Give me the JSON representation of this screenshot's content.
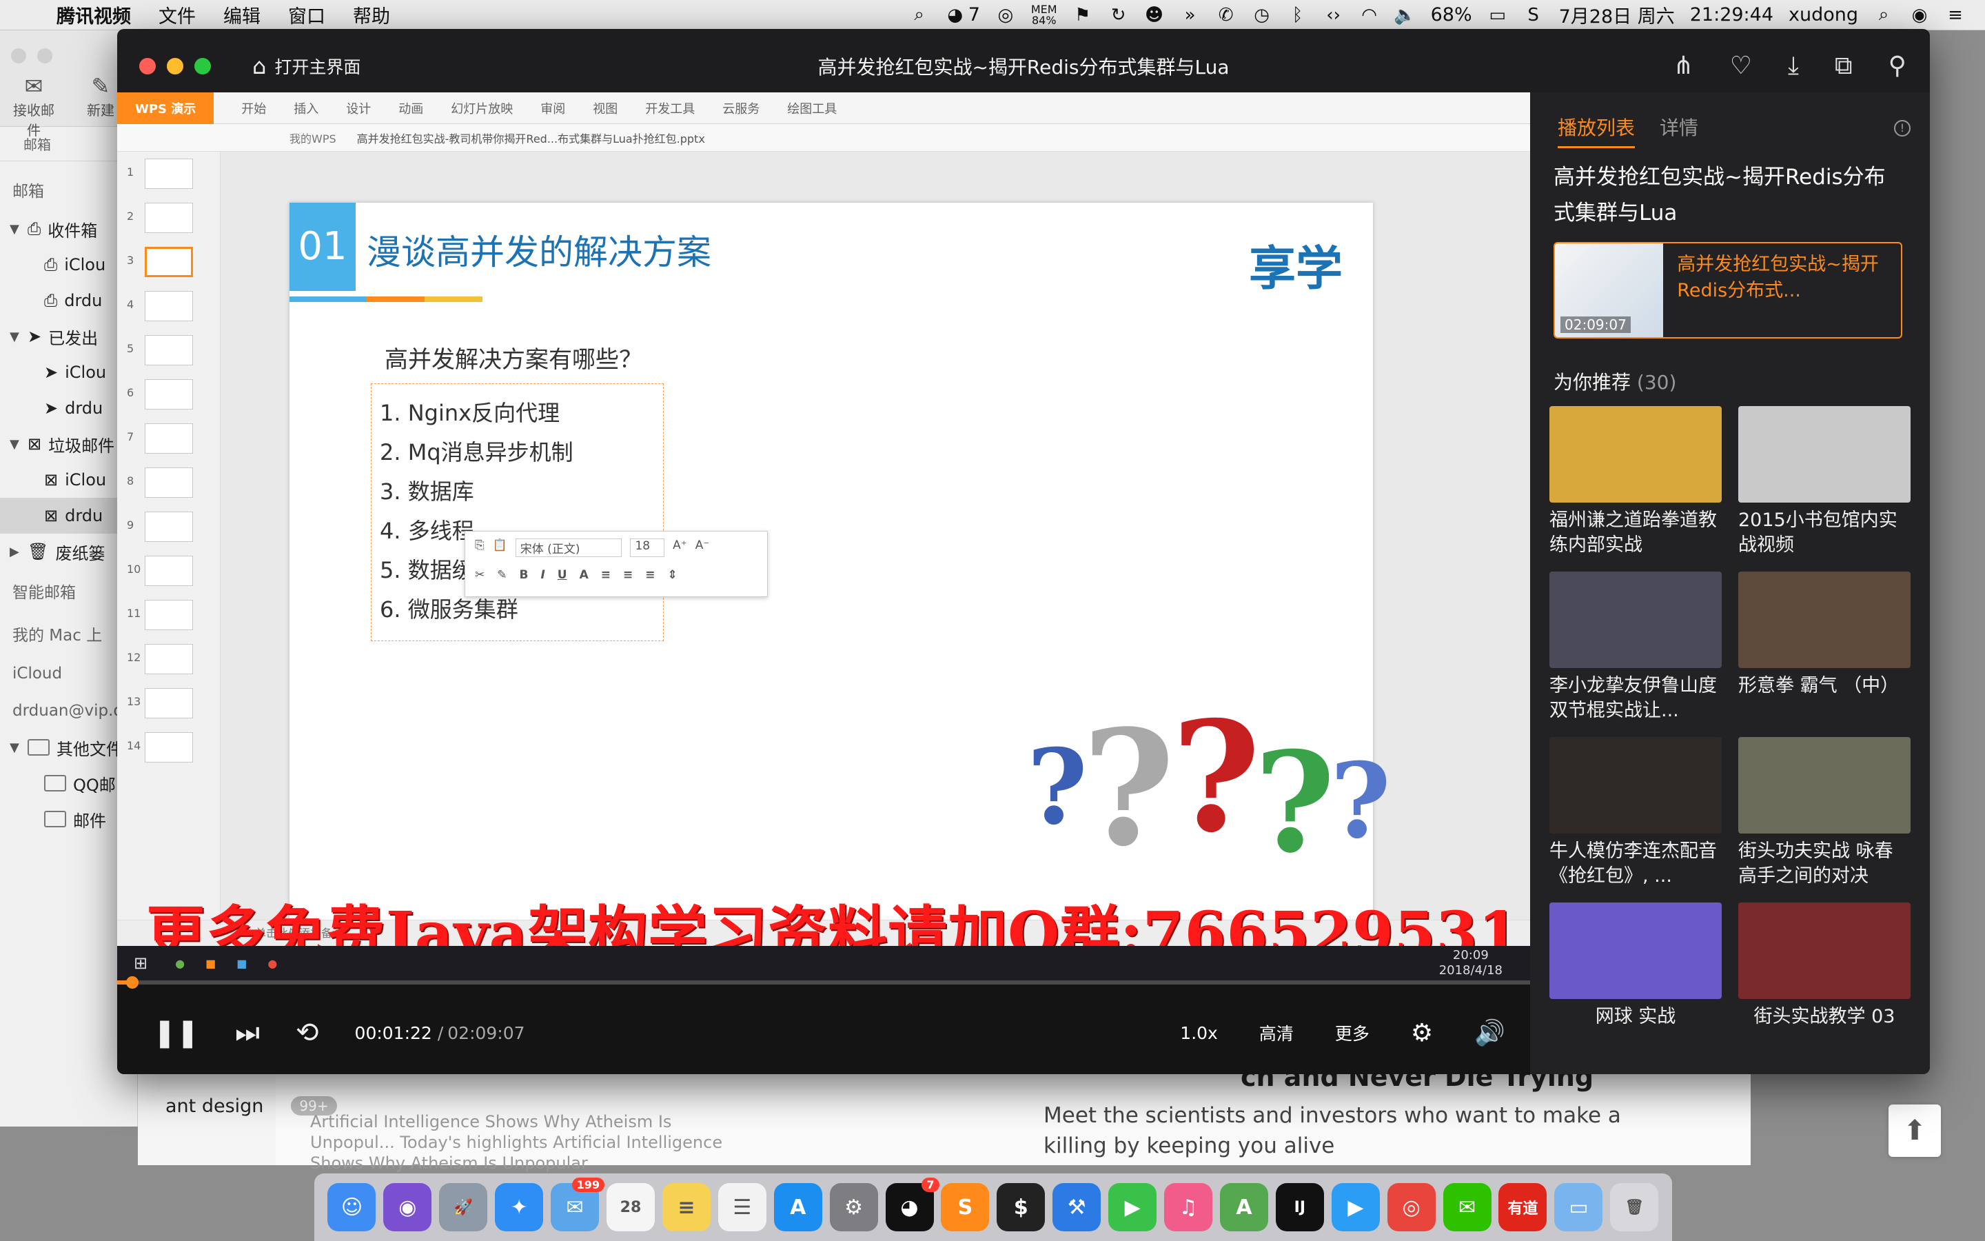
{
  "menubar": {
    "app_name": "腾讯视频",
    "menus": [
      "文件",
      "编辑",
      "窗口",
      "帮助"
    ],
    "qq_count": "7",
    "mem_label": "MEM",
    "mem_value": "84%",
    "battery": "68%",
    "date": "7月28日 周六",
    "time": "21:29:44",
    "user": "xudong"
  },
  "mail": {
    "toolbar": [
      "接收邮件",
      "新建"
    ],
    "sidebar_header_mailbox": "邮箱",
    "items": [
      {
        "label": "收件箱",
        "level": 0
      },
      {
        "label": "iClou",
        "level": 1
      },
      {
        "label": "drdu",
        "level": 1
      },
      {
        "label": "已发出",
        "level": 0
      },
      {
        "label": "iClou",
        "level": 1
      },
      {
        "label": "drdu",
        "level": 1
      },
      {
        "label": "垃圾邮件",
        "level": 0
      },
      {
        "label": "iClou",
        "level": 1
      },
      {
        "label": "drdu",
        "level": 1
      },
      {
        "label": "废纸篓",
        "level": 0
      }
    ],
    "smart": "智能邮箱",
    "on_mac": "我的 Mac 上",
    "icloud": "iCloud",
    "account": "drduan@vip.q",
    "other": "其他文件",
    "others": [
      "QQ邮",
      "邮件"
    ],
    "mailbox_crumb": "邮箱"
  },
  "player": {
    "home_label": "打开主界面",
    "title": "高并发抢红包实战~揭开Redis分布式集群与Lua",
    "time_current": "00:01:22",
    "time_separator": "/",
    "time_total": "02:09:07",
    "progress": 0.0106,
    "speed": "1.0x",
    "quality": "高清",
    "more": "更多"
  },
  "playlist": {
    "tab_playlist": "播放列表",
    "tab_detail": "详情",
    "series_title": "高并发抢红包实战~揭开Redis分布式集群与Lua",
    "current_name": "高并发抢红包实战~揭开Redis分布式...",
    "current_duration": "02:09:07",
    "recommend_label": "为你推荐",
    "recommend_count": "(30)",
    "recommend": [
      {
        "name": "福州谦之道跆拳道教练内部实战",
        "color": "#d9a83c"
      },
      {
        "name": "2015小书包馆内实战视频",
        "color": "#c9c9c9"
      },
      {
        "name": "李小龙挚友伊鲁山度 双节棍实战让...",
        "color": "#4a4a58"
      },
      {
        "name": "形意拳 霸气 （中）",
        "color": "#5d4a3a"
      },
      {
        "name": "牛人模仿李连杰配音《抢红包》, ...",
        "color": "#2f2a28"
      },
      {
        "name": "街头功夫实战 咏春高手之间的对决",
        "color": "#6b6b5a"
      },
      {
        "name": "网球 实战",
        "color": "#6a5ac8"
      },
      {
        "name": "街头实战教学 03",
        "color": "#7a2a2a"
      }
    ]
  },
  "wps": {
    "logo": "WPS 演示",
    "menus": [
      "开始",
      "插入",
      "设计",
      "动画",
      "幻灯片放映",
      "审阅",
      "视图",
      "开发工具",
      "云服务",
      "绘图工具"
    ],
    "tabs": [
      "我的WPS",
      "高并发抢红包实战-教司机带你揭开Red...布式集群与Lua扑抢红包.pptx"
    ],
    "slide_number": "01",
    "slide_heading": "漫谈高并发的解决方案",
    "brand": "享学",
    "question": "高并发解决方案有哪些？",
    "list": [
      "1.  Nginx反向代理",
      "2.  Mq消息异步机制",
      "3.  数据库",
      "4.  多线程",
      "5.  数据缓存",
      "6.  微服务集群"
    ],
    "font_name": "宋体 (正文)",
    "font_size": "18",
    "status_note": "单击此处添加备注",
    "taskbar_time": "20:09",
    "taskbar_date": "2018/4/18",
    "watermark": "更多免费Java架构学习资料请加Q群:766529531"
  },
  "background": {
    "ant_label": "ant design",
    "ant_badge": "99+",
    "feed_headline": "ch and Never Die Trying",
    "feed_sub": "Meet the scientists and investors who want to make a killing by keeping you alive",
    "feed_small": "Artificial Intelligence Shows Why Atheism Is Unpopul... Today's highlights Artificial Intelligence Shows Why Atheism Is Unpopular"
  },
  "dock": {
    "apps": [
      {
        "name": "finder",
        "color": "#3d8df5",
        "glyph": "☺"
      },
      {
        "name": "siri",
        "color": "#7a4fd0",
        "glyph": "◉"
      },
      {
        "name": "launchpad",
        "color": "#8e9aa8",
        "glyph": "🚀"
      },
      {
        "name": "safari",
        "color": "#2f8ef5",
        "glyph": "✦"
      },
      {
        "name": "mail",
        "color": "#5aa6e8",
        "glyph": "✉",
        "badge": "199"
      },
      {
        "name": "calendar",
        "color": "#f5f5f5",
        "glyph": "28"
      },
      {
        "name": "notes",
        "color": "#f7d154",
        "glyph": "≡"
      },
      {
        "name": "reminders",
        "color": "#f2f2f2",
        "glyph": "☰"
      },
      {
        "name": "app-store",
        "color": "#1c8ef0",
        "glyph": "A"
      },
      {
        "name": "system-preferences",
        "color": "#7d7d82",
        "glyph": "⚙"
      },
      {
        "name": "qq",
        "color": "#111111",
        "glyph": "◕",
        "badge": "7"
      },
      {
        "name": "sublime",
        "color": "#ff8a1c",
        "glyph": "S"
      },
      {
        "name": "terminal",
        "color": "#222222",
        "glyph": "$"
      },
      {
        "name": "xcode",
        "color": "#2c7be5",
        "glyph": "⚒"
      },
      {
        "name": "facetime",
        "color": "#3ac14a",
        "glyph": "▶"
      },
      {
        "name": "itunes",
        "color": "#f25c8a",
        "glyph": "♫"
      },
      {
        "name": "android-studio",
        "color": "#56a850",
        "glyph": "A"
      },
      {
        "name": "intellij",
        "color": "#111111",
        "glyph": "IJ"
      },
      {
        "name": "tencent-video",
        "color": "#2b9df4",
        "glyph": "▶"
      },
      {
        "name": "chrome",
        "color": "#e8453c",
        "glyph": "◎"
      },
      {
        "name": "wechat",
        "color": "#2dc100",
        "glyph": "✉"
      },
      {
        "name": "youdao",
        "color": "#e0251b",
        "glyph": "有道"
      },
      {
        "name": "downloads",
        "color": "#7ab4ef",
        "glyph": "▭"
      },
      {
        "name": "trash",
        "color": "#d8d8dc",
        "glyph": "🗑"
      }
    ]
  }
}
